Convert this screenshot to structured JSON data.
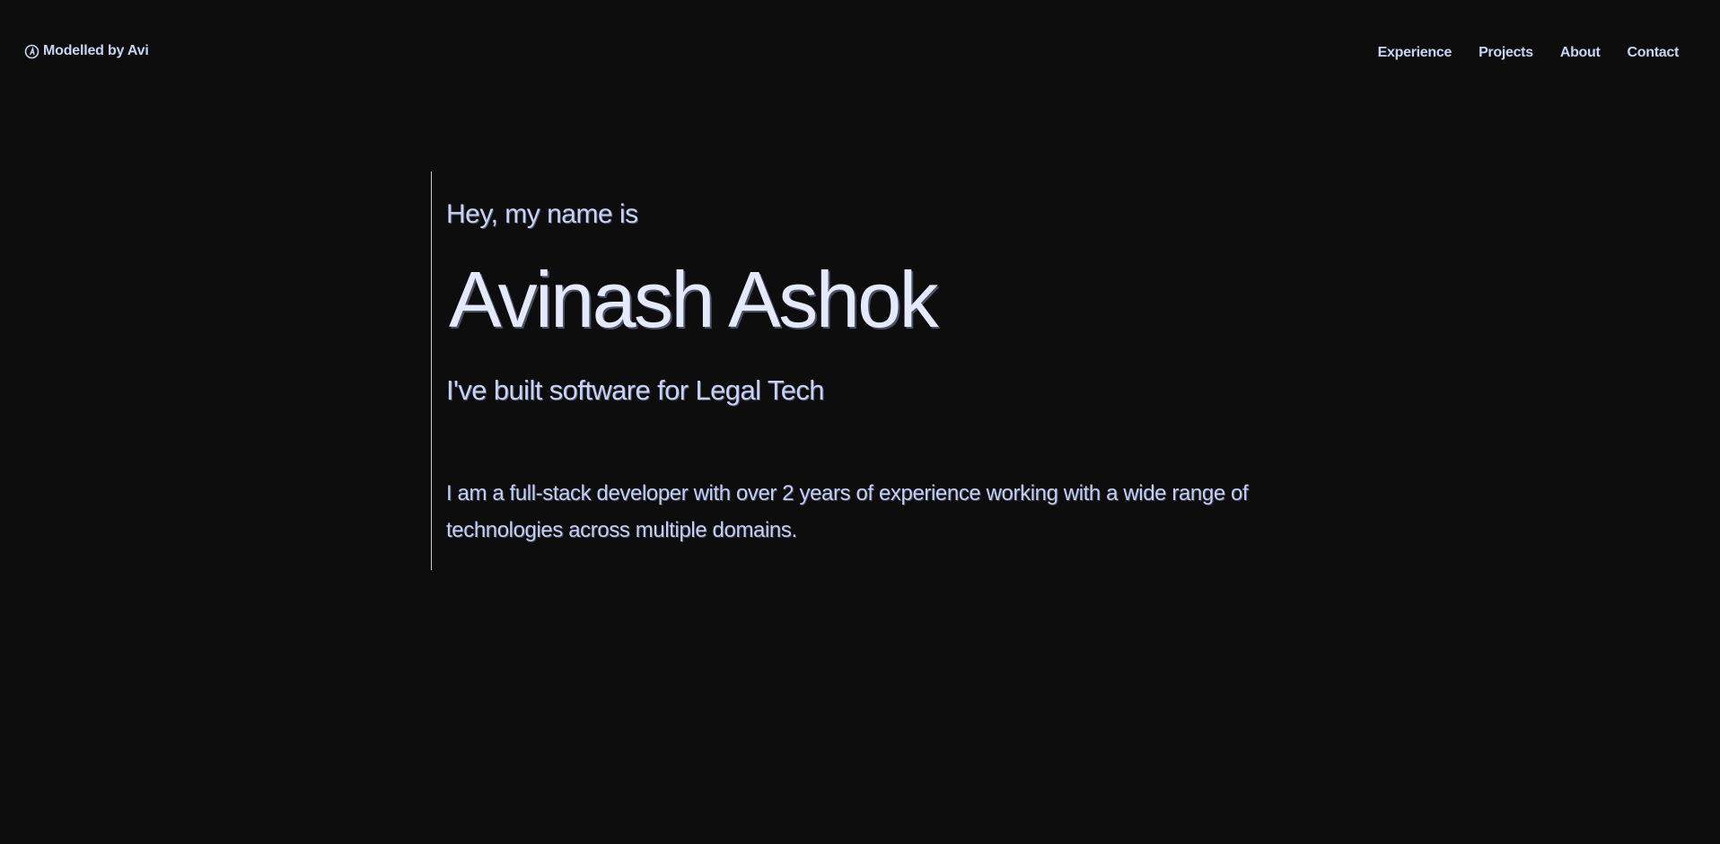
{
  "header": {
    "brand_label": "Modelled by Avi",
    "brand_icon": "logo-circle-icon",
    "nav": [
      {
        "label": "Experience"
      },
      {
        "label": "Projects"
      },
      {
        "label": "About"
      },
      {
        "label": "Contact"
      }
    ]
  },
  "hero": {
    "greeting": "Hey, my name is",
    "name": "Avinash Ashok",
    "tagline": "I've built software for Legal Tech",
    "bio": "I am a full-stack developer with over 2 years of experience working with a wide range of technologies across multiple domains."
  },
  "colors": {
    "background": "#0d0d0d",
    "text_primary": "#e4e9fb",
    "text_secondary": "#c7d3f4",
    "divider": "#c9cbd4"
  }
}
